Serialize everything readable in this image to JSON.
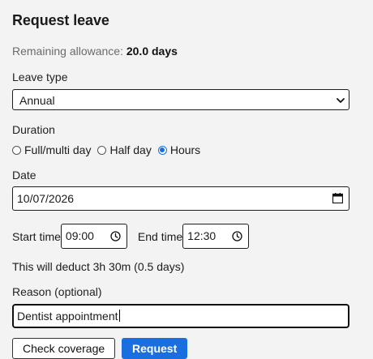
{
  "form": {
    "title": "Request leave",
    "allowance_label": "Remaining allowance:",
    "allowance_value": "20.0 days",
    "leave_type_label": "Leave type",
    "leave_type_value": "Annual",
    "duration_label": "Duration",
    "duration_options": [
      "Full/multi day",
      "Half day",
      "Hours"
    ],
    "duration_selected": "Hours",
    "date_label": "Date",
    "date_value": "10/07/2026",
    "start_time_label": "Start time",
    "start_time_value": "09:00",
    "end_time_label": "End time",
    "end_time_value": "12:30",
    "deduction_text": "This will deduct 3h 30m (0.5 days)",
    "reason_label": "Reason (optional)",
    "reason_value": "Dentist appointment",
    "check_coverage_label": "Check coverage",
    "request_label": "Request"
  },
  "colors": {
    "accent": "#1a6fe0",
    "background": "#f3f3f3"
  },
  "icons": {
    "select": "chevron-down-icon",
    "date": "calendar-icon",
    "time": "clock-icon"
  }
}
